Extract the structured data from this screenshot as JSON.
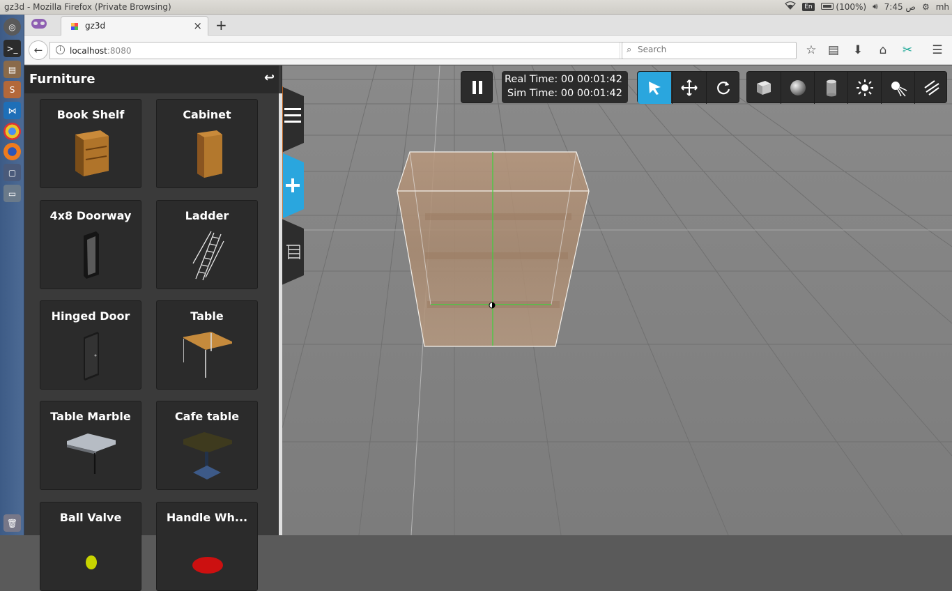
{
  "os": {
    "window_title": "gz3d - Mozilla Firefox (Private Browsing)",
    "keyboard_layout": "En",
    "battery": "(100%)",
    "time": "ص 7:45",
    "user": "mh"
  },
  "browser": {
    "tab_title": "gz3d",
    "url_host": "localhost",
    "url_port": ":8080",
    "search_placeholder": "Search"
  },
  "panel": {
    "title": "Furniture",
    "items": [
      {
        "label": "Book Shelf"
      },
      {
        "label": "Cabinet"
      },
      {
        "label": "4x8 Doorway"
      },
      {
        "label": "Ladder"
      },
      {
        "label": "Hinged Door"
      },
      {
        "label": "Table"
      },
      {
        "label": "Table Marble"
      },
      {
        "label": "Cafe table"
      },
      {
        "label": "Ball Valve"
      },
      {
        "label": "Handle Wh..."
      }
    ]
  },
  "sim": {
    "real_time": "Real Time: 00 00:01:42",
    "sim_time": "Sim Time: 00 00:01:42"
  },
  "colors": {
    "accent": "#2aa6de",
    "panel_bg": "#3a3a3a",
    "ground": "#828282"
  }
}
